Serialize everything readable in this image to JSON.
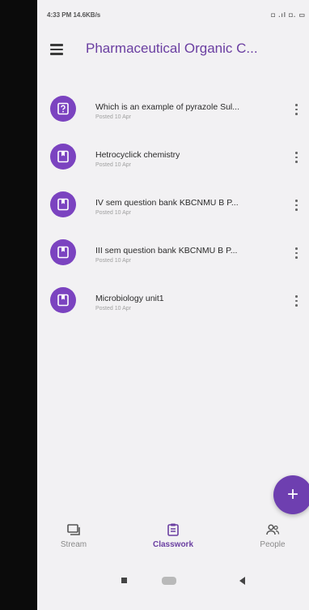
{
  "status_bar": {
    "time_speed": "4:33 PM 14.6KB/s",
    "right_indicators": "◘ .ıl ◘. ▭"
  },
  "app_bar": {
    "title": "Pharmaceutical Organic C..."
  },
  "items": [
    {
      "title": "Which is an example of pyrazole Sul...",
      "posted": "Posted 10 Apr",
      "icon": "question-icon"
    },
    {
      "title": "Hetrocyclick chemistry",
      "posted": "Posted 10 Apr",
      "icon": "material-icon"
    },
    {
      "title": "IV sem question bank KBCNMU B P...",
      "posted": "Posted 10 Apr",
      "icon": "material-icon"
    },
    {
      "title": "III sem question bank KBCNMU B P...",
      "posted": "Posted 10 Apr",
      "icon": "material-icon"
    },
    {
      "title": "Microbiology unit1",
      "posted": "Posted 10 Apr",
      "icon": "material-icon"
    }
  ],
  "fab": {
    "label": "+"
  },
  "bottom_nav": [
    {
      "label": "Stream",
      "icon": "stream-icon",
      "active": false
    },
    {
      "label": "Classwork",
      "icon": "classwork-icon",
      "active": true
    },
    {
      "label": "People",
      "icon": "people-icon",
      "active": false
    }
  ],
  "colors": {
    "accent": "#6a3ea1",
    "icon_bg": "#7b43c0",
    "background": "#f2f1f3"
  }
}
